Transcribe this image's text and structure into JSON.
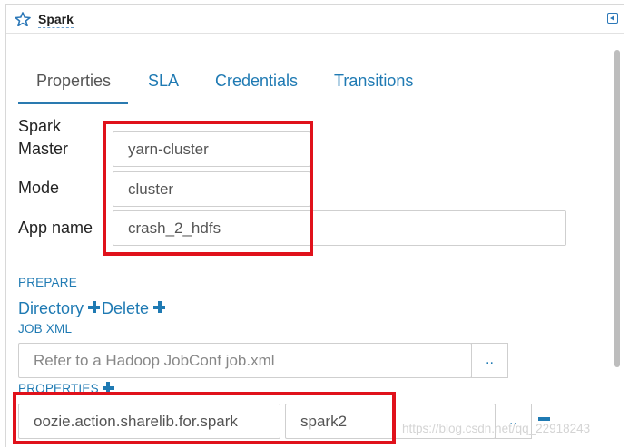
{
  "panel": {
    "title": "Spark",
    "title_icon": "star-workflow-icon",
    "collapse_icon": "collapse-icon"
  },
  "tabs": [
    {
      "label": "Properties",
      "active": true
    },
    {
      "label": "SLA",
      "active": false
    },
    {
      "label": "Credentials",
      "active": false
    },
    {
      "label": "Transitions",
      "active": false
    }
  ],
  "form": {
    "spark_master_label_line1": "Spark",
    "spark_master_label_line2": "Master",
    "spark_master_value": "yarn-cluster",
    "mode_label": "Mode",
    "mode_value": "cluster",
    "app_name_label": "App name",
    "app_name_value": "crash_2_hdfs"
  },
  "prepare": {
    "heading": "PREPARE",
    "directory_label": "Directory",
    "delete_label": "Delete"
  },
  "job_xml": {
    "heading": "JOB XML",
    "placeholder": "Refer to a Hadoop JobConf job.xml",
    "browse_label": ".."
  },
  "properties": {
    "heading": "PROPERTIES",
    "rows": [
      {
        "key": "oozie.action.sharelib.for.spark",
        "value": "spark2",
        "browse_label": ".."
      }
    ]
  },
  "watermark": "https://blog.csdn.net/qq_22918243",
  "colors": {
    "accent": "#1f7ab3",
    "highlight_box": "#e0111b"
  }
}
